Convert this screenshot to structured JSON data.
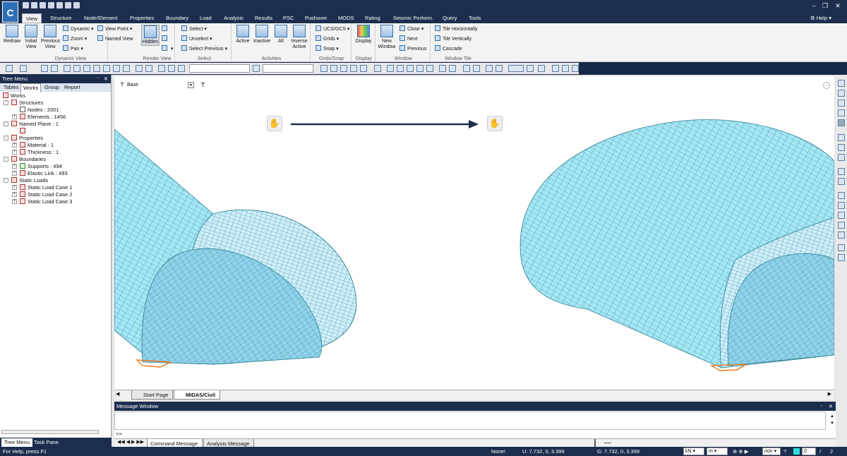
{
  "app": {
    "logo_text": "C",
    "colors": {
      "titlebar": "#1c2d4e",
      "accent": "#2f6fb7",
      "mesh_fill": "#9fe3f2",
      "mesh_line": "#2b7f91",
      "arrow": "#1c2d4e",
      "support": "#e87a1e"
    }
  },
  "menu_tabs": [
    "View",
    "Structure",
    "Node/Element",
    "Properties",
    "Boundary",
    "Load",
    "Analysis",
    "Results",
    "PSC",
    "Pushover",
    "MODS",
    "Rating",
    "Seismic Perform.",
    "Query",
    "Tools"
  ],
  "help_label": "Help",
  "ribbon": {
    "dynamic_view": {
      "label": "Dynamic View",
      "redraw": "Redraw",
      "initial_view": "Initial View",
      "previous_view": "Previous View",
      "dynamic": "Dynamic",
      "zoom": "Zoom",
      "pan": "Pan",
      "view_point": "View Point",
      "named_view": "Named View"
    },
    "render_view": {
      "label": "Render View",
      "hidden": "Hidden"
    },
    "select": {
      "label": "Select",
      "select": "Select",
      "unselect": "Unselect",
      "select_previous": "Select Previous"
    },
    "activities": {
      "label": "Activities",
      "active": "Active",
      "inactive": "Inactive",
      "all": "All",
      "inverse_active": "Inverse Active"
    },
    "grids_snap": {
      "label": "Grids/Snap",
      "ucs_gcs": "UCS/GCS",
      "grids": "Grids",
      "snap": "Snap"
    },
    "display": {
      "label": "Display",
      "display": "Display"
    },
    "window": {
      "label": "Window",
      "new_window": "New Window",
      "close": "Close",
      "next": "Next",
      "previous": "Previous"
    },
    "window_tile": {
      "label": "Window Tile",
      "tile_horizontally": "Tile Horizontally",
      "tile_vertically": "Tile Vertically",
      "cascade": "Cascade"
    }
  },
  "tree_menu": {
    "title": "Tree Menu",
    "tabs": [
      "Tables",
      "Works",
      "Group",
      "Report"
    ],
    "nodes": {
      "works": "Works",
      "structures": "Structures",
      "nodes": "Nodes : 2001",
      "elements": "Elements : 1456",
      "named_plane": "Named Plane : 1",
      "properties": "Properties",
      "material": "Material : 1",
      "thickness": "Thickness : 1",
      "boundaries": "Boundaries",
      "supports": "Supports : 494",
      "elastic_link": "Elastic Link : 493",
      "static_loads": "Static Loads",
      "load_case_1": "Static Load Case 1",
      "load_case_2": "Static Load Case 2",
      "load_case_3": "Static Load Case 3"
    },
    "bottom_tabs": [
      "Tree Menu",
      "Task Pane"
    ]
  },
  "viewport": {
    "base_label": "Base"
  },
  "document_tabs": [
    "Start Page",
    "MIDAS/Civil"
  ],
  "message_window": {
    "title": "Message Window",
    "prompt": ">>",
    "tabs": [
      "Command Message",
      "Analysis Message"
    ]
  },
  "status": {
    "help": "For Help, press F1",
    "none": "None!",
    "u_coord": "U: 7.732, 0, 3.399",
    "g_coord": "G: 7.732, 0, 3.399",
    "force_unit": "kN",
    "length_unit": "m",
    "mode": "non",
    "spin_value": "0",
    "page_sep": "/",
    "page_total": "2"
  }
}
